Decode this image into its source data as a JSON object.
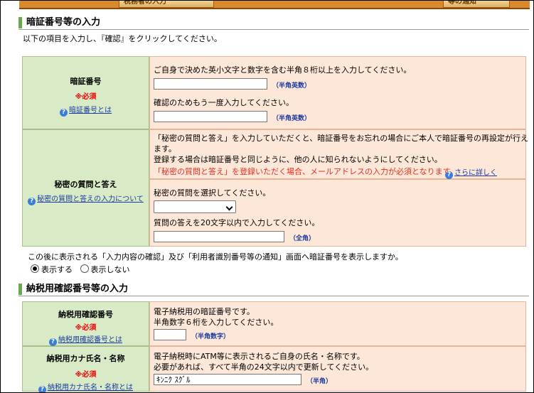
{
  "tabs": {
    "left": "税務者の入力",
    "right": "等の通知"
  },
  "sec1": {
    "title": "暗証番号等の入力",
    "intro": "以下の項目を入力し、『確認』をクリックしてください。",
    "pin": {
      "label": "暗証番号",
      "required": "※必須",
      "help": "暗証番号とは",
      "desc": "ご自身で決めた英小文字と数字を含む半角８桁以上を入力してください。",
      "hint1": "（半角英数）",
      "confirm": "確認のためもう一度入力してください。",
      "hint2": "（半角英数）"
    },
    "secret": {
      "label": "秘密の質問と答え",
      "help": "秘密の質問と答えの入力について",
      "desc1": "「秘密の質問と答え」を入力していただくと、暗証番号をお忘れの場合にご本人で暗証番号の再設定が行え",
      "desc2": "ます。",
      "desc3": "登録する場合は暗証番号と同じように、他の人に知られないようにしてください。",
      "warn": "「秘密の質問と答え」を登録いただく場合、メールアドレスの入力が必須となります。",
      "more": "さらに詳しく",
      "select_label": "秘密の質問を選択してください。",
      "answer_label": "質問の答えを20文字以内で入力してください。",
      "hint": "（全角）"
    },
    "display_q": "この後に表示される「入力内容の確認」及び「利用者識別番号等の通知」画面へ暗証番号を表示しますか。",
    "opt_show": "表示する",
    "opt_hide": "表示しない"
  },
  "sec2": {
    "title": "納税用確認番号等の入力",
    "code": {
      "label": "納税用確認番号",
      "required": "※必須",
      "help": "納税用確認番号とは",
      "desc1": "電子納税用の暗証番号です。",
      "desc2": "半角数字６桁を入力してください。",
      "hint": "（半角数字）"
    },
    "kana": {
      "label": "納税用カナ氏名・名称",
      "required": "※必須",
      "help": "納税用カナ氏名・名称とは",
      "desc1": "電子納税時にATM等に表示されるご自身の氏名・名称です。",
      "desc2": "必要があれば、すべて半角の24文字以内で更新してください。",
      "value": "ｷﾝﾆｸ ｽｸﾞﾙ",
      "hint": "（半角）"
    }
  },
  "icons": {
    "help": "question-circle-icon"
  },
  "colors": {
    "label_bg": "#d9ebc6",
    "input_bg": "#fde7d8",
    "accent": "#6aa84f",
    "required": "#e00000"
  }
}
